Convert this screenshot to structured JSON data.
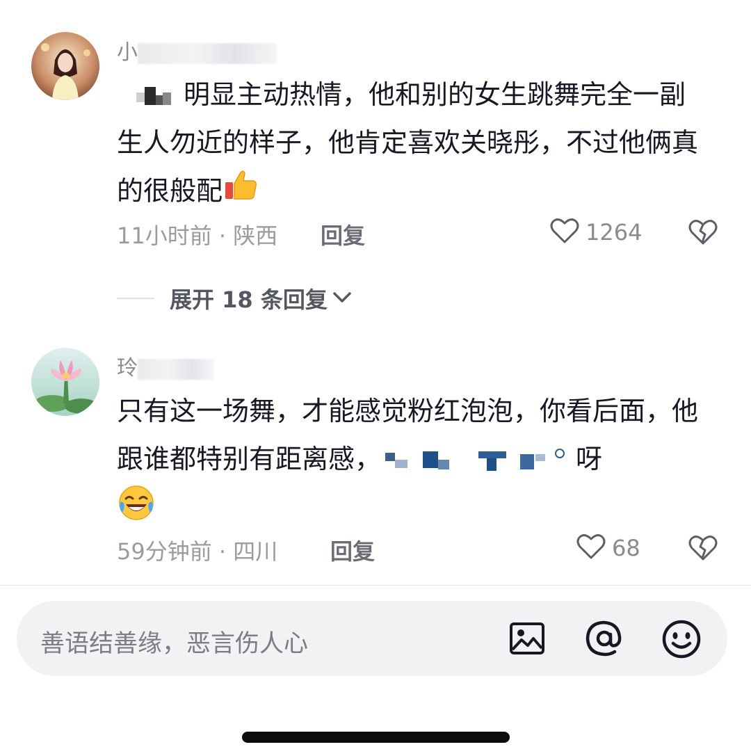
{
  "comments": [
    {
      "username": "小",
      "text_suffix": "明显主动热情，他和别的女生跳舞完全一副生人勿近的样子，他肯定喜欢关晓彤，不过他俩真的很般配",
      "emoji": "thumbs-up-icon",
      "time_location": "11小时前 · 陕西",
      "reply_label": "回复",
      "like_count": "1264",
      "expand_replies": "展开 18 条回复"
    },
    {
      "username": "玲",
      "text_prefix": "只有这一场舞，才能感觉粉红泡泡，你看后面，他跟谁都特别有距离感，",
      "text_suffix": "呀",
      "emoji": "laughing-crying-icon",
      "time_location": "59分钟前 · 四川",
      "reply_label": "回复",
      "like_count": "68"
    }
  ],
  "input": {
    "placeholder": "善语结善缘，恶言伤人心"
  },
  "icons": {
    "image": "image-icon",
    "mention": "at-icon",
    "emoji": "smiley-icon",
    "like": "heart-icon",
    "dislike": "broken-heart-icon",
    "expand": "chevron-down-icon"
  }
}
